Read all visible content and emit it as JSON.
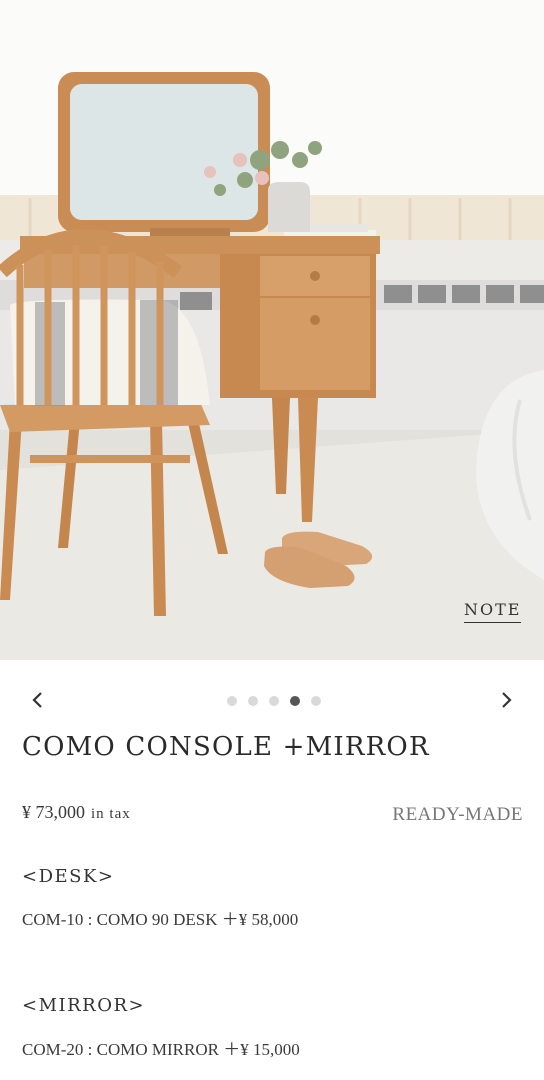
{
  "gallery": {
    "image_alt": "Como console desk with mirror, Windsor chair and slippers",
    "note_link": "NOTE",
    "slide_count": 5,
    "active_slide": 4
  },
  "product": {
    "title": "COMO CONSOLE +MIRROR",
    "price": "¥ 73,000",
    "tax_label": "in tax",
    "badge": "READY-MADE"
  },
  "sections": [
    {
      "heading": "<DESK>",
      "item": "COM-10 : COMO 90 DESK ＋¥ 58,000"
    },
    {
      "heading": "<MIRROR>",
      "item": "COM-20 : COMO MIRROR ＋¥ 15,000"
    }
  ],
  "colors": {
    "wood": "#c98c55",
    "text": "#2b2b2b",
    "dot_active": "#555555",
    "dot_inactive": "#d9d9d9"
  }
}
